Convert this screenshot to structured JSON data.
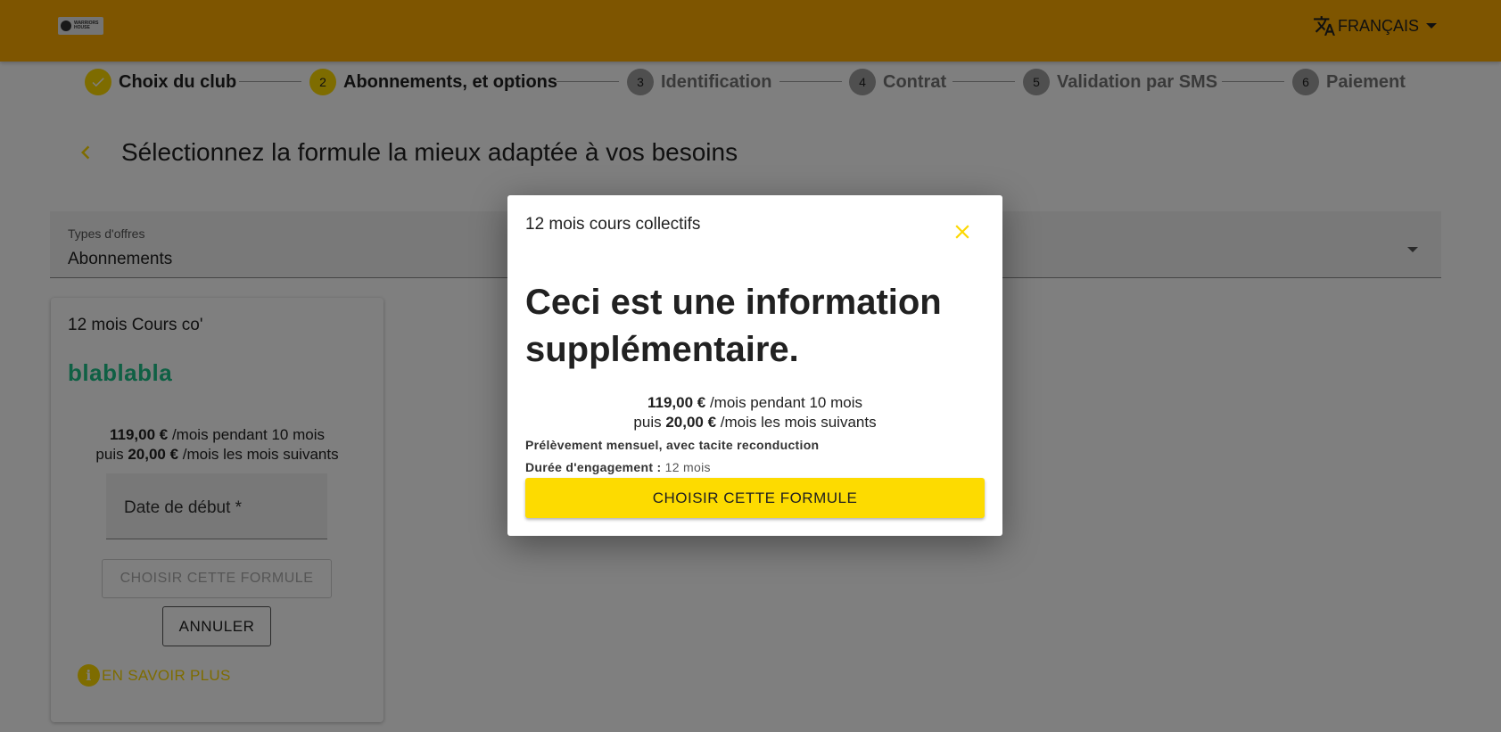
{
  "header": {
    "logo_text": "WARRIORS HOUSE",
    "language": "FRANÇAIS"
  },
  "stepper": {
    "steps": [
      {
        "number": "",
        "label": "Choix du club",
        "state": "done"
      },
      {
        "number": "2",
        "label": "Abonnements, et options",
        "state": "active"
      },
      {
        "number": "3",
        "label": "Identification",
        "state": "todo"
      },
      {
        "number": "4",
        "label": "Contrat",
        "state": "todo"
      },
      {
        "number": "5",
        "label": "Validation par SMS",
        "state": "todo"
      },
      {
        "number": "6",
        "label": "Paiement",
        "state": "todo"
      }
    ]
  },
  "page": {
    "title": "Sélectionnez la formule la mieux adaptée à vos besoins"
  },
  "offer_select": {
    "label": "Types d'offres",
    "value": "Abonnements"
  },
  "card": {
    "name": "12 mois Cours co'",
    "slogan": "blablabla",
    "price_first": "119,00 €",
    "price_first_suffix": " /mois pendant 10 mois",
    "price_then_prefix": "puis ",
    "price_then": "20,00 €",
    "price_then_suffix": " /mois les mois suivants",
    "date_placeholder": "Date de début *",
    "choose_label": "CHOISIR CETTE FORMULE",
    "cancel_label": "ANNULER",
    "more_label": "EN SAVOIR PLUS"
  },
  "dialog": {
    "title": "12 mois cours collectifs",
    "info": "Ceci est une information supplémentaire.",
    "price_first": "119,00 €",
    "price_first_suffix": " /mois pendant 10 mois",
    "price_then_prefix": "puis ",
    "price_then": "20,00 €",
    "price_then_suffix": " /mois les mois suivants",
    "note": "Prélèvement mensuel, avec tacite reconduction",
    "duration_label": "Durée d'engagement :",
    "duration_value": " 12 mois",
    "choose_label": "CHOISIR CETTE FORMULE"
  },
  "colors": {
    "header_bg": "#fdaa00",
    "accent_yellow": "#fdd800",
    "slogan_green": "#1ec089"
  }
}
